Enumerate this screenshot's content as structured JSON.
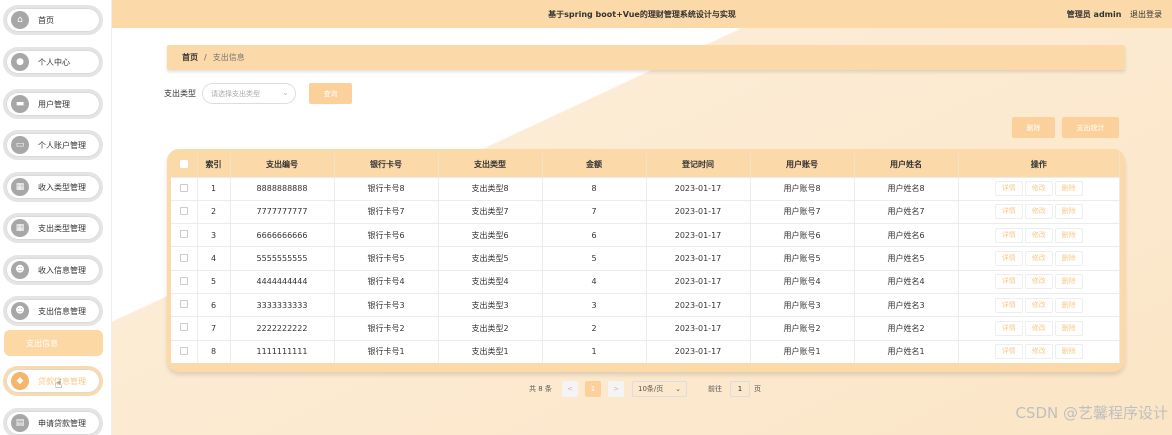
{
  "app": {
    "title": "基于spring boot+Vue的理财管理系统设计与实现",
    "user_label": "管理员 admin",
    "logout": "退出登录"
  },
  "sidebar": {
    "items": [
      {
        "label": "首页",
        "icon": "home-icon"
      },
      {
        "label": "个人中心",
        "icon": "user-icon"
      },
      {
        "label": "用户管理",
        "icon": "users-icon"
      },
      {
        "label": "个人账户管理",
        "icon": "wallet-icon"
      },
      {
        "label": "收入类型管理",
        "icon": "grid-icon"
      },
      {
        "label": "支出类型管理",
        "icon": "grid-icon"
      },
      {
        "label": "收入信息管理",
        "icon": "people-icon"
      },
      {
        "label": "支出信息管理",
        "icon": "people-icon"
      },
      {
        "label": "支出信息",
        "icon": "",
        "sub": true
      },
      {
        "label": "贷款信息管理",
        "icon": "money-icon"
      },
      {
        "label": "申请贷款管理",
        "icon": "doc-icon"
      }
    ]
  },
  "breadcrumb": {
    "home": "首页",
    "separator": "/",
    "current": "支出信息"
  },
  "filter": {
    "label": "支出类型",
    "placeholder": "请选择支出类型",
    "query_button": "查询"
  },
  "actions": {
    "delete": "删除",
    "stats": "支出统计"
  },
  "table": {
    "headers": [
      "索引",
      "支出编号",
      "银行卡号",
      "支出类型",
      "金额",
      "登记时间",
      "用户账号",
      "用户姓名",
      "操作"
    ],
    "row_actions": [
      "详情",
      "修改",
      "删除"
    ],
    "rows": [
      [
        "1",
        "8888888888",
        "银行卡号8",
        "支出类型8",
        "8",
        "2023-01-17",
        "用户账号8",
        "用户姓名8"
      ],
      [
        "2",
        "7777777777",
        "银行卡号7",
        "支出类型7",
        "7",
        "2023-01-17",
        "用户账号7",
        "用户姓名7"
      ],
      [
        "3",
        "6666666666",
        "银行卡号6",
        "支出类型6",
        "6",
        "2023-01-17",
        "用户账号6",
        "用户姓名6"
      ],
      [
        "4",
        "5555555555",
        "银行卡号5",
        "支出类型5",
        "5",
        "2023-01-17",
        "用户账号5",
        "用户姓名5"
      ],
      [
        "5",
        "4444444444",
        "银行卡号4",
        "支出类型4",
        "4",
        "2023-01-17",
        "用户账号4",
        "用户姓名4"
      ],
      [
        "6",
        "3333333333",
        "银行卡号3",
        "支出类型3",
        "3",
        "2023-01-17",
        "用户账号3",
        "用户姓名3"
      ],
      [
        "7",
        "2222222222",
        "银行卡号2",
        "支出类型2",
        "2",
        "2023-01-17",
        "用户账号2",
        "用户姓名2"
      ],
      [
        "8",
        "1111111111",
        "银行卡号1",
        "支出类型1",
        "1",
        "2023-01-17",
        "用户账号1",
        "用户姓名1"
      ]
    ]
  },
  "pagination": {
    "total": "共 8 条",
    "prev": "<",
    "current_page": "1",
    "next": ">",
    "page_size": "10条/页",
    "goto_label": "前往",
    "goto_value": "1",
    "page_unit": "页"
  },
  "watermark": "CSDN @艺馨程序设计",
  "colors": {
    "accent": "#fcd9a8",
    "button": "#fcd09a",
    "action_text": "#f7c98c"
  }
}
